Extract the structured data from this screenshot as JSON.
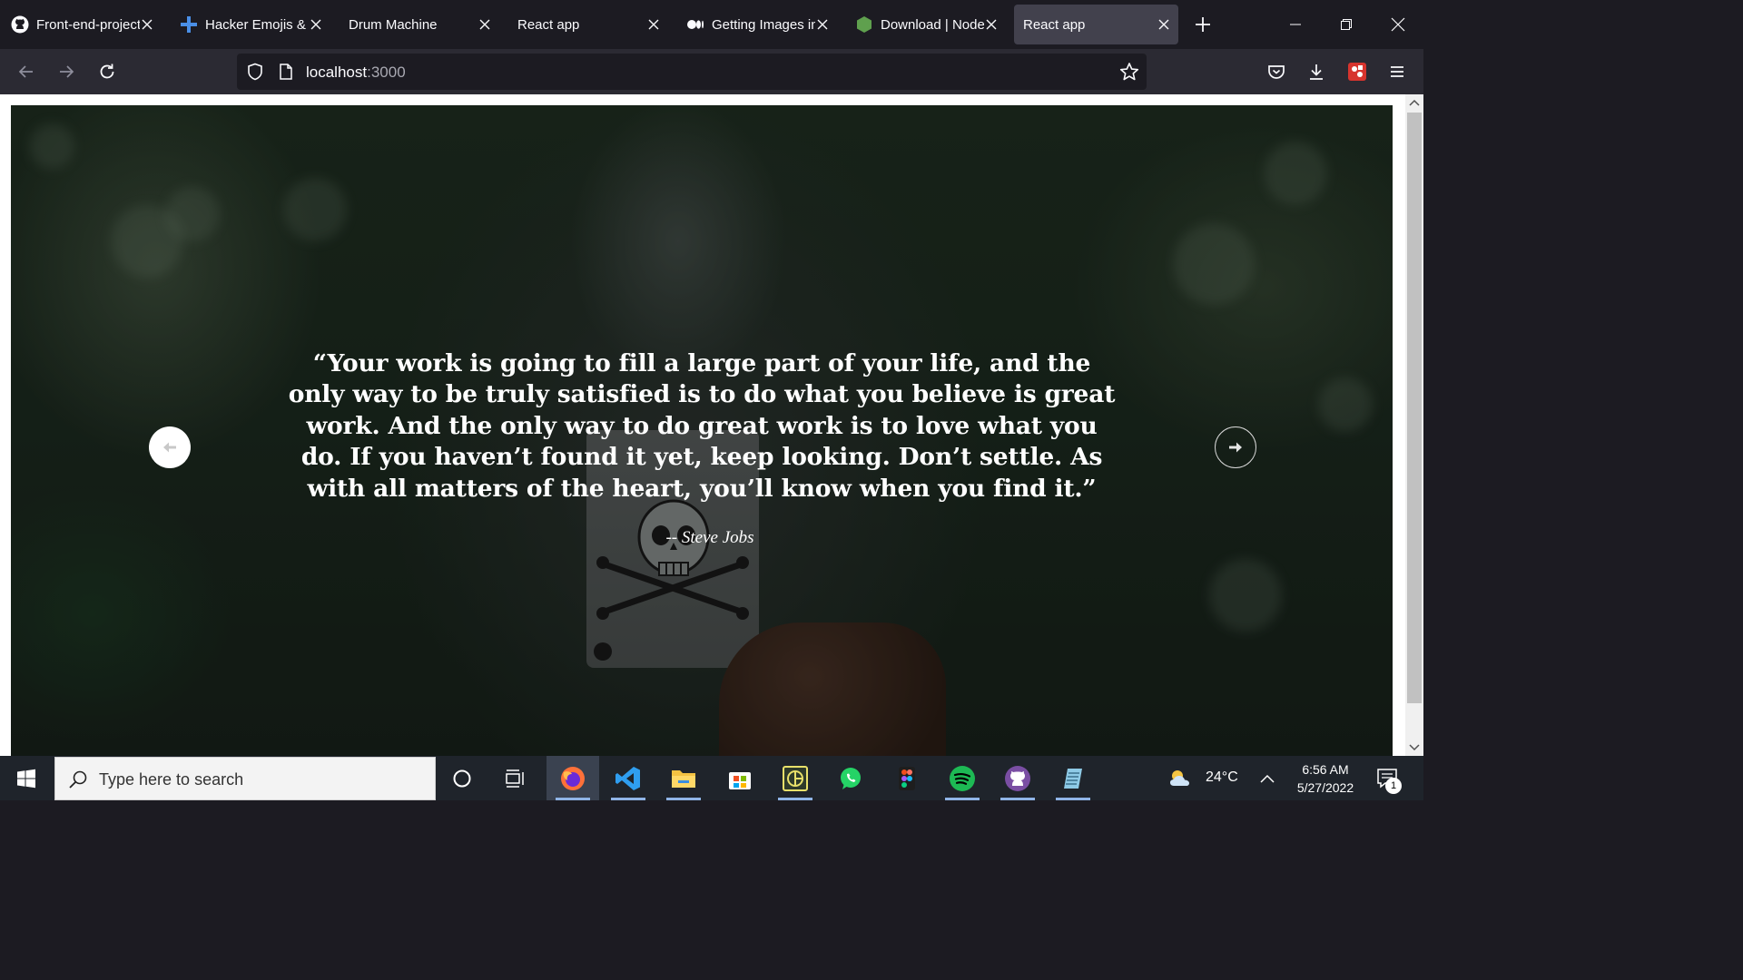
{
  "browser": {
    "tabs": [
      {
        "title": "Front-end-project",
        "icon": "github-icon",
        "active": false
      },
      {
        "title": "Hacker Emojis & T",
        "icon": "plus-cross-icon",
        "active": false
      },
      {
        "title": "Drum Machine",
        "icon": "",
        "active": false
      },
      {
        "title": "React app",
        "icon": "",
        "active": false
      },
      {
        "title": "Getting Images in",
        "icon": "medium-icon",
        "active": false
      },
      {
        "title": "Download | Node",
        "icon": "node-icon",
        "active": false
      },
      {
        "title": "React app",
        "icon": "",
        "active": true
      }
    ],
    "url_host": "localhost",
    "url_port": ":3000"
  },
  "slide": {
    "quote": "“Your work is going to fill a large part of your life, and the only way to be truly satisfied is to do what you believe is great work. And the only way to do great work is to love what you do. If you haven’t found it yet, keep looking. Don’t settle. As with all matters of the heart, you’ll know when you find it.”",
    "author": "-- Steve Jobs"
  },
  "taskbar": {
    "search_placeholder": "Type here to search",
    "temperature": "24°C",
    "time": "6:56 AM",
    "date": "5/27/2022",
    "notification_count": "1",
    "apps": [
      "firefox-icon",
      "vscode-icon",
      "file-explorer-icon",
      "microsoft-store-icon",
      "app-icon",
      "whatsapp-icon",
      "figma-icon",
      "spotify-icon",
      "github-desktop-icon",
      "notepad-icon"
    ]
  },
  "colors": {
    "accent_firefox": "#ff7139",
    "spotify": "#1db954",
    "whatsapp": "#25d366"
  }
}
